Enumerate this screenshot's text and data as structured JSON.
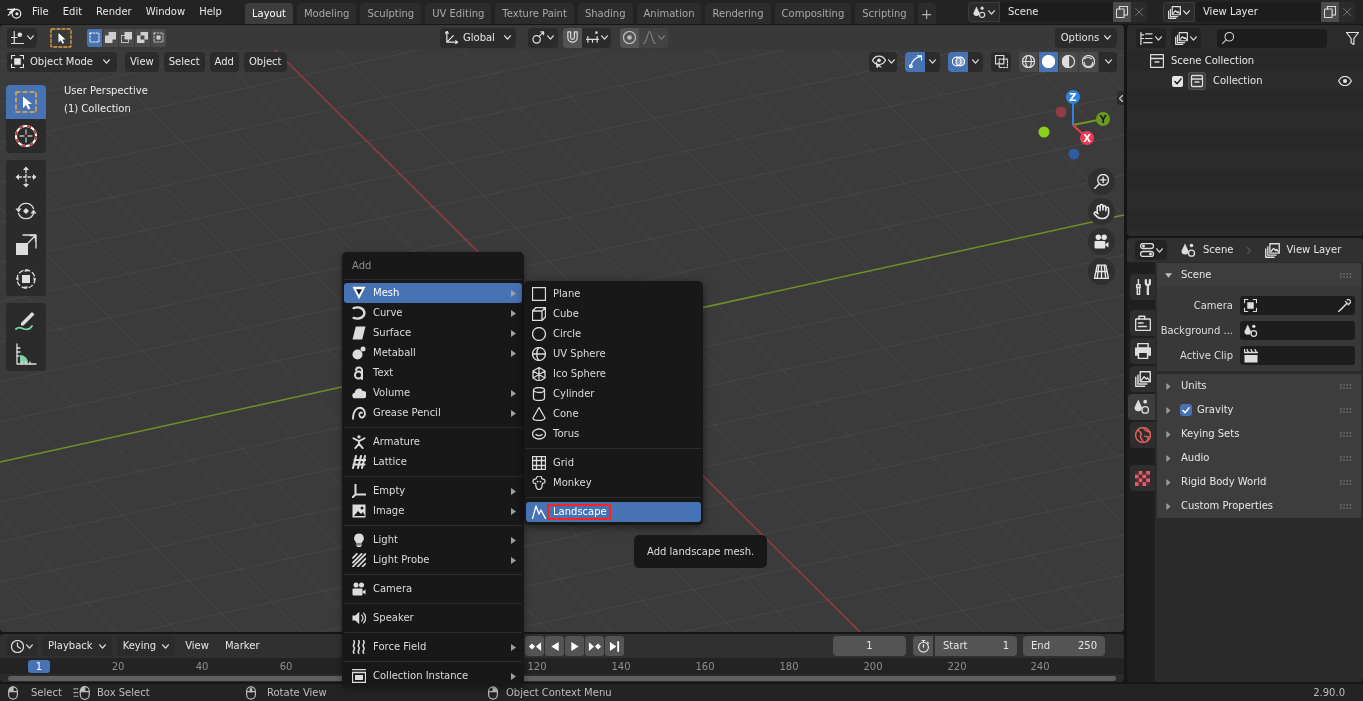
{
  "top_bar": {
    "menus": [
      "File",
      "Edit",
      "Render",
      "Window",
      "Help"
    ],
    "workspaces": [
      {
        "label": "Layout",
        "selected": true
      },
      {
        "label": "Modeling",
        "selected": false
      },
      {
        "label": "Sculpting",
        "selected": false
      },
      {
        "label": "UV Editing",
        "selected": false
      },
      {
        "label": "Texture Paint",
        "selected": false
      },
      {
        "label": "Shading",
        "selected": false
      },
      {
        "label": "Animation",
        "selected": false
      },
      {
        "label": "Rendering",
        "selected": false
      },
      {
        "label": "Compositing",
        "selected": false
      },
      {
        "label": "Scripting",
        "selected": false
      }
    ],
    "add_workspace": "+",
    "scene": "Scene",
    "view_layer": "View Layer"
  },
  "tool_header": {
    "select_modes": [
      {
        "selected": true
      },
      {
        "selected": false
      },
      {
        "selected": false
      },
      {
        "selected": false
      },
      {
        "selected": false
      }
    ],
    "orientation": "Global",
    "snap": {
      "on": false
    },
    "proportional": {
      "on": false
    },
    "options": "Options"
  },
  "viewport_header": {
    "mode": "Object Mode",
    "menus": [
      "View",
      "Select",
      "Add",
      "Object"
    ],
    "toggles": [
      {
        "on": true
      },
      {
        "on": true
      },
      {
        "on": false
      }
    ],
    "shading": [
      {
        "selected": false
      },
      {
        "selected": true
      },
      {
        "selected": false
      },
      {
        "selected": false
      }
    ]
  },
  "toolbar": {
    "groups": [
      {
        "tools": [
          {
            "selected": true
          },
          {
            "selected": false
          }
        ]
      },
      {
        "tools": [
          {
            "selected": false
          },
          {
            "selected": false
          },
          {
            "selected": false
          },
          {
            "selected": false
          }
        ]
      },
      {
        "tools": [
          {
            "selected": false
          },
          {
            "selected": false
          }
        ]
      }
    ]
  },
  "viewport": {
    "view_name": "User Perspective",
    "collection": "(1) Collection",
    "gizmo_axes": [
      "Z",
      "Y",
      "X"
    ]
  },
  "add_menu": {
    "title": "Add",
    "groups": [
      {
        "items": [
          {
            "label": "Mesh",
            "submenu": true,
            "selected": true
          },
          {
            "label": "Curve",
            "submenu": true,
            "selected": false
          },
          {
            "label": "Surface",
            "submenu": true,
            "selected": false
          },
          {
            "label": "Metaball",
            "submenu": true,
            "selected": false
          },
          {
            "label": "Text",
            "submenu": false,
            "selected": false
          },
          {
            "label": "Volume",
            "submenu": true,
            "selected": false
          },
          {
            "label": "Grease Pencil",
            "submenu": true,
            "selected": false
          }
        ]
      },
      {
        "items": [
          {
            "label": "Armature",
            "submenu": false,
            "selected": false
          },
          {
            "label": "Lattice",
            "submenu": false,
            "selected": false
          }
        ]
      },
      {
        "items": [
          {
            "label": "Empty",
            "submenu": true,
            "selected": false
          },
          {
            "label": "Image",
            "submenu": true,
            "selected": false
          }
        ]
      },
      {
        "items": [
          {
            "label": "Light",
            "submenu": true,
            "selected": false
          },
          {
            "label": "Light Probe",
            "submenu": true,
            "selected": false
          }
        ]
      },
      {
        "items": [
          {
            "label": "Camera",
            "submenu": false,
            "selected": false
          }
        ]
      },
      {
        "items": [
          {
            "label": "Speaker",
            "submenu": false,
            "selected": false
          }
        ]
      },
      {
        "items": [
          {
            "label": "Force Field",
            "submenu": true,
            "selected": false
          }
        ]
      },
      {
        "items": [
          {
            "label": "Collection Instance",
            "submenu": true,
            "selected": false
          }
        ]
      }
    ]
  },
  "mesh_submenu": {
    "groups": [
      {
        "items": [
          {
            "label": "Plane",
            "selected": false,
            "highlight": false
          },
          {
            "label": "Cube",
            "selected": false,
            "highlight": false
          },
          {
            "label": "Circle",
            "selected": false,
            "highlight": false
          },
          {
            "label": "UV Sphere",
            "selected": false,
            "highlight": false
          },
          {
            "label": "Ico Sphere",
            "selected": false,
            "highlight": false
          },
          {
            "label": "Cylinder",
            "selected": false,
            "highlight": false
          },
          {
            "label": "Cone",
            "selected": false,
            "highlight": false
          },
          {
            "label": "Torus",
            "selected": false,
            "highlight": false
          }
        ]
      },
      {
        "items": [
          {
            "label": "Grid",
            "selected": false,
            "highlight": false
          },
          {
            "label": "Monkey",
            "selected": false,
            "highlight": false
          }
        ]
      },
      {
        "items": [
          {
            "label": "Landscape",
            "selected": true,
            "highlight": true
          }
        ]
      }
    ]
  },
  "tooltip": {
    "text": "Add landscape mesh."
  },
  "outliner": {
    "tree": [
      {
        "label": "Scene Collection",
        "children": [
          {
            "label": "Collection",
            "checked": true,
            "visible": true
          }
        ]
      }
    ]
  },
  "properties": {
    "context": [
      "Scene",
      "View Layer"
    ],
    "tabs": [
      {
        "selected": false
      },
      {
        "selected": false
      },
      {
        "selected": false
      },
      {
        "selected": false
      },
      {
        "selected": true
      },
      {
        "selected": false
      },
      {
        "selected": false
      }
    ],
    "panels": [
      {
        "title": "Scene",
        "kind": "plain",
        "expanded": true,
        "fields": [
          {
            "label": "Camera"
          },
          {
            "label": "Background ..."
          },
          {
            "label": "Active Clip"
          }
        ]
      },
      {
        "title": "Units",
        "kind": "plain",
        "expanded": false
      },
      {
        "title": "Gravity",
        "kind": "toggle",
        "checked": true,
        "expanded": false
      },
      {
        "title": "Keying Sets",
        "kind": "plain",
        "expanded": false
      },
      {
        "title": "Audio",
        "kind": "plain",
        "expanded": false
      },
      {
        "title": "Rigid Body World",
        "kind": "plain",
        "expanded": false
      },
      {
        "title": "Custom Properties",
        "kind": "plain",
        "expanded": false
      }
    ]
  },
  "timeline": {
    "menus": [
      {
        "label": "Playback",
        "kind": "dropdown"
      },
      {
        "label": "Keying",
        "kind": "dropdown"
      },
      {
        "label": "View",
        "kind": "menu"
      },
      {
        "label": "Marker",
        "kind": "menu"
      }
    ],
    "current_frame": "1",
    "start": {
      "label": "Start",
      "value": "1"
    },
    "end": {
      "label": "End",
      "value": "250"
    },
    "playhead": "1",
    "ruler": [
      "20",
      "40",
      "60",
      "120",
      "140",
      "160",
      "180",
      "200",
      "220",
      "240"
    ]
  },
  "status_bar": {
    "hints": [
      "Select",
      "Box Select",
      "Rotate View",
      "Object Context Menu"
    ],
    "version": "2.90.0"
  }
}
